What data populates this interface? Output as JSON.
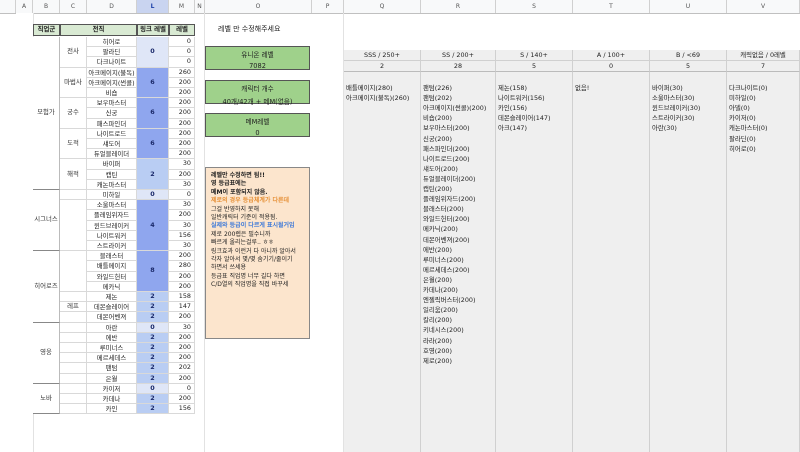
{
  "columns": [
    "A",
    "B",
    "C",
    "D",
    "L",
    "M",
    "N",
    "O",
    "P",
    "Q",
    "R",
    "S",
    "T",
    "U",
    "V"
  ],
  "headers": {
    "job_group": "직업군",
    "job": "전직",
    "link_level": "링크 레벨",
    "level": "레벨"
  },
  "note_title": "레벨 만 수정해주세요",
  "union": {
    "label": "유니온 레벨",
    "value": "7082"
  },
  "char_count": {
    "label": "캐릭터 개수",
    "value": "40개/42개 + 메M(없음)"
  },
  "mm_level": {
    "label": "메M레벨",
    "value": "0"
  },
  "note_lines": [
    {
      "text": "레벨만 수정하면 됨!!",
      "style": "b"
    },
    {
      "text": " ",
      "style": ""
    },
    {
      "text": "영 등급표에는",
      "style": "b"
    },
    {
      "text": "메M이 포함되지 않음.",
      "style": "b"
    },
    {
      "text": " ",
      "style": ""
    },
    {
      "text": "제로의 경우 등급체계가 다른데",
      "style": "o"
    },
    {
      "text": "그걸 반영하지 못해",
      "style": ""
    },
    {
      "text": "일반캐릭터 기준이 적용됨.",
      "style": ""
    },
    {
      "text": "실제와 등급이 다르게 표시될거임",
      "style": "bl"
    },
    {
      "text": " ",
      "style": ""
    },
    {
      "text": "제로 200렙은 필수니까",
      "style": ""
    },
    {
      "text": "빠르게 올리는걸루.. ㅎㅎ",
      "style": ""
    },
    {
      "text": " ",
      "style": ""
    },
    {
      "text": "링크효과 이런거 다 아니까 알아서",
      "style": ""
    },
    {
      "text": "각자 알아서 몇/몇 숨기기/줄이기",
      "style": ""
    },
    {
      "text": "하면서 쓰세용",
      "style": ""
    },
    {
      "text": " ",
      "style": ""
    },
    {
      "text": "등급표 직업명 너무 길다 하면",
      "style": ""
    },
    {
      "text": "C/D열의 직업명을 직접 바꾸세",
      "style": ""
    }
  ],
  "groups": [
    {
      "name": "모험가",
      "subgroups": [
        {
          "name": "전사",
          "rank": "0",
          "rows": [
            {
              "job": "히어로",
              "level": "0"
            },
            {
              "job": "팔라딘",
              "level": "0"
            },
            {
              "job": "다크나이트",
              "level": "0"
            }
          ]
        },
        {
          "name": "마법사",
          "rank": "6",
          "rows": [
            {
              "job": "아크메이지(불독)",
              "level": "260"
            },
            {
              "job": "아크메이지(썬콜)",
              "level": "200"
            },
            {
              "job": "비숍",
              "level": "200"
            }
          ]
        },
        {
          "name": "궁수",
          "rank": "6",
          "rows": [
            {
              "job": "보우마스터",
              "level": "200"
            },
            {
              "job": "신궁",
              "level": "200"
            },
            {
              "job": "패스파인더",
              "level": "200"
            }
          ]
        },
        {
          "name": "도적",
          "rank": "6",
          "rows": [
            {
              "job": "나이트로드",
              "level": "200"
            },
            {
              "job": "섀도어",
              "level": "200"
            },
            {
              "job": "듀얼블레이더",
              "level": "200"
            }
          ]
        },
        {
          "name": "해적",
          "rank": "2",
          "rows": [
            {
              "job": "바이퍼",
              "level": "30"
            },
            {
              "job": "캡틴",
              "level": "200"
            },
            {
              "job": "캐논마스터",
              "level": "30"
            }
          ]
        }
      ]
    },
    {
      "name": "시그너스",
      "subgroups": [
        {
          "name": "",
          "rank": "0",
          "rows": [
            {
              "job": "미하일",
              "level": "0"
            }
          ]
        },
        {
          "name": "",
          "rank": "4",
          "rows": [
            {
              "job": "소울마스터",
              "level": "30"
            },
            {
              "job": "플레임위자드",
              "level": "200"
            },
            {
              "job": "윈드브레이커",
              "level": "30"
            },
            {
              "job": "나이트워커",
              "level": "156"
            },
            {
              "job": "스트라이커",
              "level": "30"
            }
          ]
        }
      ]
    },
    {
      "name": "히어로즈",
      "subgroups": [
        {
          "name": "",
          "rank": "8",
          "rows": [
            {
              "job": "블래스터",
              "level": "200"
            },
            {
              "job": "배틀메이지",
              "level": "280"
            },
            {
              "job": "와일드헌터",
              "level": "200"
            },
            {
              "job": "메카닉",
              "level": "200"
            }
          ]
        },
        {
          "name": "",
          "rank": "2",
          "rows": [
            {
              "job": "제논",
              "level": "158"
            }
          ]
        },
        {
          "name": "레프",
          "rank": "2",
          "rows": [
            {
              "job": "데몬슬레이어",
              "level": "147"
            }
          ]
        },
        {
          "name": "",
          "rank": "2",
          "rows": [
            {
              "job": "데몬어벤져",
              "level": "200"
            }
          ]
        }
      ]
    },
    {
      "name": "영웅",
      "subgroups": [
        {
          "name": "",
          "rank": "0",
          "rows": [
            {
              "job": "아란",
              "level": "30"
            }
          ]
        },
        {
          "name": "",
          "rank": "2",
          "rows": [
            {
              "job": "에반",
              "level": "200"
            }
          ]
        },
        {
          "name": "",
          "rank": "2",
          "rows": [
            {
              "job": "루미너스",
              "level": "200"
            }
          ]
        },
        {
          "name": "",
          "rank": "2",
          "rows": [
            {
              "job": "메르세데스",
              "level": "200"
            }
          ]
        },
        {
          "name": "",
          "rank": "2",
          "rows": [
            {
              "job": "팬텀",
              "level": "202"
            }
          ]
        },
        {
          "name": "",
          "rank": "2",
          "rows": [
            {
              "job": "은월",
              "level": "200"
            }
          ]
        }
      ]
    },
    {
      "name": "노바",
      "subgroups": [
        {
          "name": "",
          "rank": "0",
          "rows": [
            {
              "job": "카이저",
              "level": "0"
            }
          ]
        },
        {
          "name": "",
          "rank": "2",
          "rows": [
            {
              "job": "카데나",
              "level": "200"
            }
          ]
        },
        {
          "name": "",
          "rank": "2",
          "rows": [
            {
              "job": "카인",
              "level": "156"
            }
          ]
        }
      ]
    }
  ],
  "tiers": [
    {
      "label": "SSS / 250+",
      "count": "2",
      "items": [
        "배틀메이지(280)",
        "아크메이지(불독)(260)"
      ]
    },
    {
      "label": "SS / 200+",
      "count": "28",
      "items": [
        "팬텀(226)",
        "팬텀(202)",
        "아크메이지(썬콜)(200)",
        "비숍(200)",
        "보우마스터(200)",
        "신궁(200)",
        "패스파인더(200)",
        "나이트로드(200)",
        "섀도어(200)",
        "듀얼블레이더(200)",
        "캡틴(200)",
        "플레임위자드(200)",
        "블래스터(200)",
        "와일드헌터(200)",
        "메카닉(200)",
        "데몬어벤져(200)",
        "에반(200)",
        "루미너스(200)",
        "메르세데스(200)",
        "은월(200)",
        "카데나(200)",
        "엔젤릭버스터(200)",
        "일리움(200)",
        "칼리(200)",
        "키네시스(200)",
        "라라(200)",
        "호영(200)",
        "제로(200)"
      ]
    },
    {
      "label": "S / 140+",
      "count": "5",
      "items": [
        "제논(158)",
        "나이트워커(156)",
        "카인(156)",
        "데몬슬레이어(147)",
        "아크(147)"
      ]
    },
    {
      "label": "A / 100+",
      "count": "0",
      "items": [
        "없음!"
      ]
    },
    {
      "label": "B / <69",
      "count": "5",
      "items": [
        "바이퍼(30)",
        "소울마스터(30)",
        "윈드브레이커(30)",
        "스트라이커(30)",
        "아란(30)"
      ]
    },
    {
      "label": "캐릭없음 / 0레벨",
      "count": "7",
      "items": [
        "다크나이트(0)",
        "미하일(0)",
        "아델(0)",
        "카이저(0)",
        "캐논마스터(0)",
        "팔라딘(0)",
        "히어로(0)"
      ]
    }
  ]
}
